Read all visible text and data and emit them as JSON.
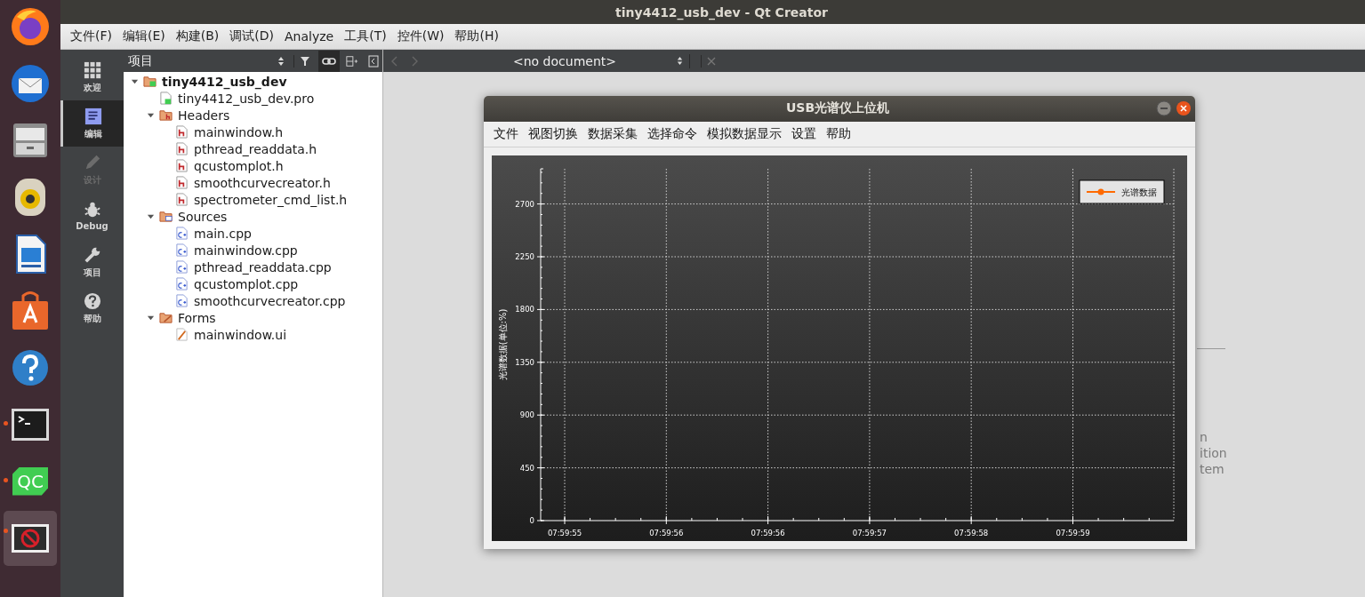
{
  "window": {
    "title": "tiny4412_usb_dev - Qt Creator"
  },
  "menu": [
    "文件(F)",
    "编辑(E)",
    "构建(B)",
    "调试(D)",
    "Analyze",
    "工具(T)",
    "控件(W)",
    "帮助(H)"
  ],
  "dock": [
    {
      "kind": "firefox",
      "running": false,
      "selected": false
    },
    {
      "kind": "mail",
      "running": false,
      "selected": false
    },
    {
      "kind": "files",
      "running": false,
      "selected": false
    },
    {
      "kind": "speaker",
      "running": false,
      "selected": false
    },
    {
      "kind": "writer",
      "running": false,
      "selected": false
    },
    {
      "kind": "store",
      "running": false,
      "selected": false
    },
    {
      "kind": "help",
      "running": false,
      "selected": false
    },
    {
      "kind": "terminal",
      "running": true,
      "selected": false
    },
    {
      "kind": "qt",
      "label": "QC",
      "running": true,
      "selected": false
    },
    {
      "kind": "blocked",
      "running": true,
      "selected": true
    }
  ],
  "modes": [
    {
      "label": "欢迎",
      "kind": "grid",
      "selected": false,
      "disabled": false
    },
    {
      "label": "编辑",
      "kind": "edit",
      "selected": true,
      "disabled": false
    },
    {
      "label": "设计",
      "kind": "pencil",
      "selected": false,
      "disabled": true
    },
    {
      "label": "Debug",
      "kind": "bug",
      "selected": false,
      "disabled": false
    },
    {
      "label": "项目",
      "kind": "wrench",
      "selected": false,
      "disabled": false
    },
    {
      "label": "帮助",
      "kind": "help",
      "selected": false,
      "disabled": false
    }
  ],
  "project_panel": {
    "title": "项目",
    "tree": [
      {
        "label": "tiny4412_usb_dev",
        "kind": "project",
        "expanded": true,
        "children": [
          {
            "label": "tiny4412_usb_dev.pro",
            "kind": "pro"
          },
          {
            "label": "Headers",
            "kind": "folder-h",
            "expanded": true,
            "children": [
              {
                "label": "mainwindow.h",
                "kind": "h"
              },
              {
                "label": "pthread_readdata.h",
                "kind": "h"
              },
              {
                "label": "qcustomplot.h",
                "kind": "h"
              },
              {
                "label": "smoothcurvecreator.h",
                "kind": "h"
              },
              {
                "label": "spectrometer_cmd_list.h",
                "kind": "h"
              }
            ]
          },
          {
            "label": "Sources",
            "kind": "folder-cpp",
            "expanded": true,
            "children": [
              {
                "label": "main.cpp",
                "kind": "cpp"
              },
              {
                "label": "mainwindow.cpp",
                "kind": "cpp"
              },
              {
                "label": "pthread_readdata.cpp",
                "kind": "cpp"
              },
              {
                "label": "qcustomplot.cpp",
                "kind": "cpp"
              },
              {
                "label": "smoothcurvecreator.cpp",
                "kind": "cpp"
              }
            ]
          },
          {
            "label": "Forms",
            "kind": "folder-ui",
            "expanded": true,
            "children": [
              {
                "label": "mainwindow.ui",
                "kind": "ui"
              }
            ]
          }
        ]
      }
    ]
  },
  "editor": {
    "document": "<no document>",
    "hidden_text": [
      "n",
      "ition",
      "tem"
    ]
  },
  "app_window": {
    "title": "USB光谱仪上位机",
    "menu": [
      "文件",
      "视图切换",
      "数据采集",
      "选择命令",
      "模拟数据显示",
      "设置",
      "帮助"
    ],
    "chart_data": {
      "type": "line",
      "ylabel": "光谱数据(单位:%)",
      "categories": [
        "07:59:55",
        "07:59:56",
        "07:59:56",
        "07:59:57",
        "07:59:58",
        "07:59:59"
      ],
      "series": [
        {
          "name": "光谱数据",
          "color": "#ff6a00",
          "values": [
            null,
            null,
            null,
            null,
            null,
            null
          ]
        }
      ],
      "grid": true,
      "ylim": [
        0,
        3000
      ],
      "yticks": [
        0,
        450,
        900,
        1350,
        1800,
        2250,
        2700
      ]
    }
  }
}
